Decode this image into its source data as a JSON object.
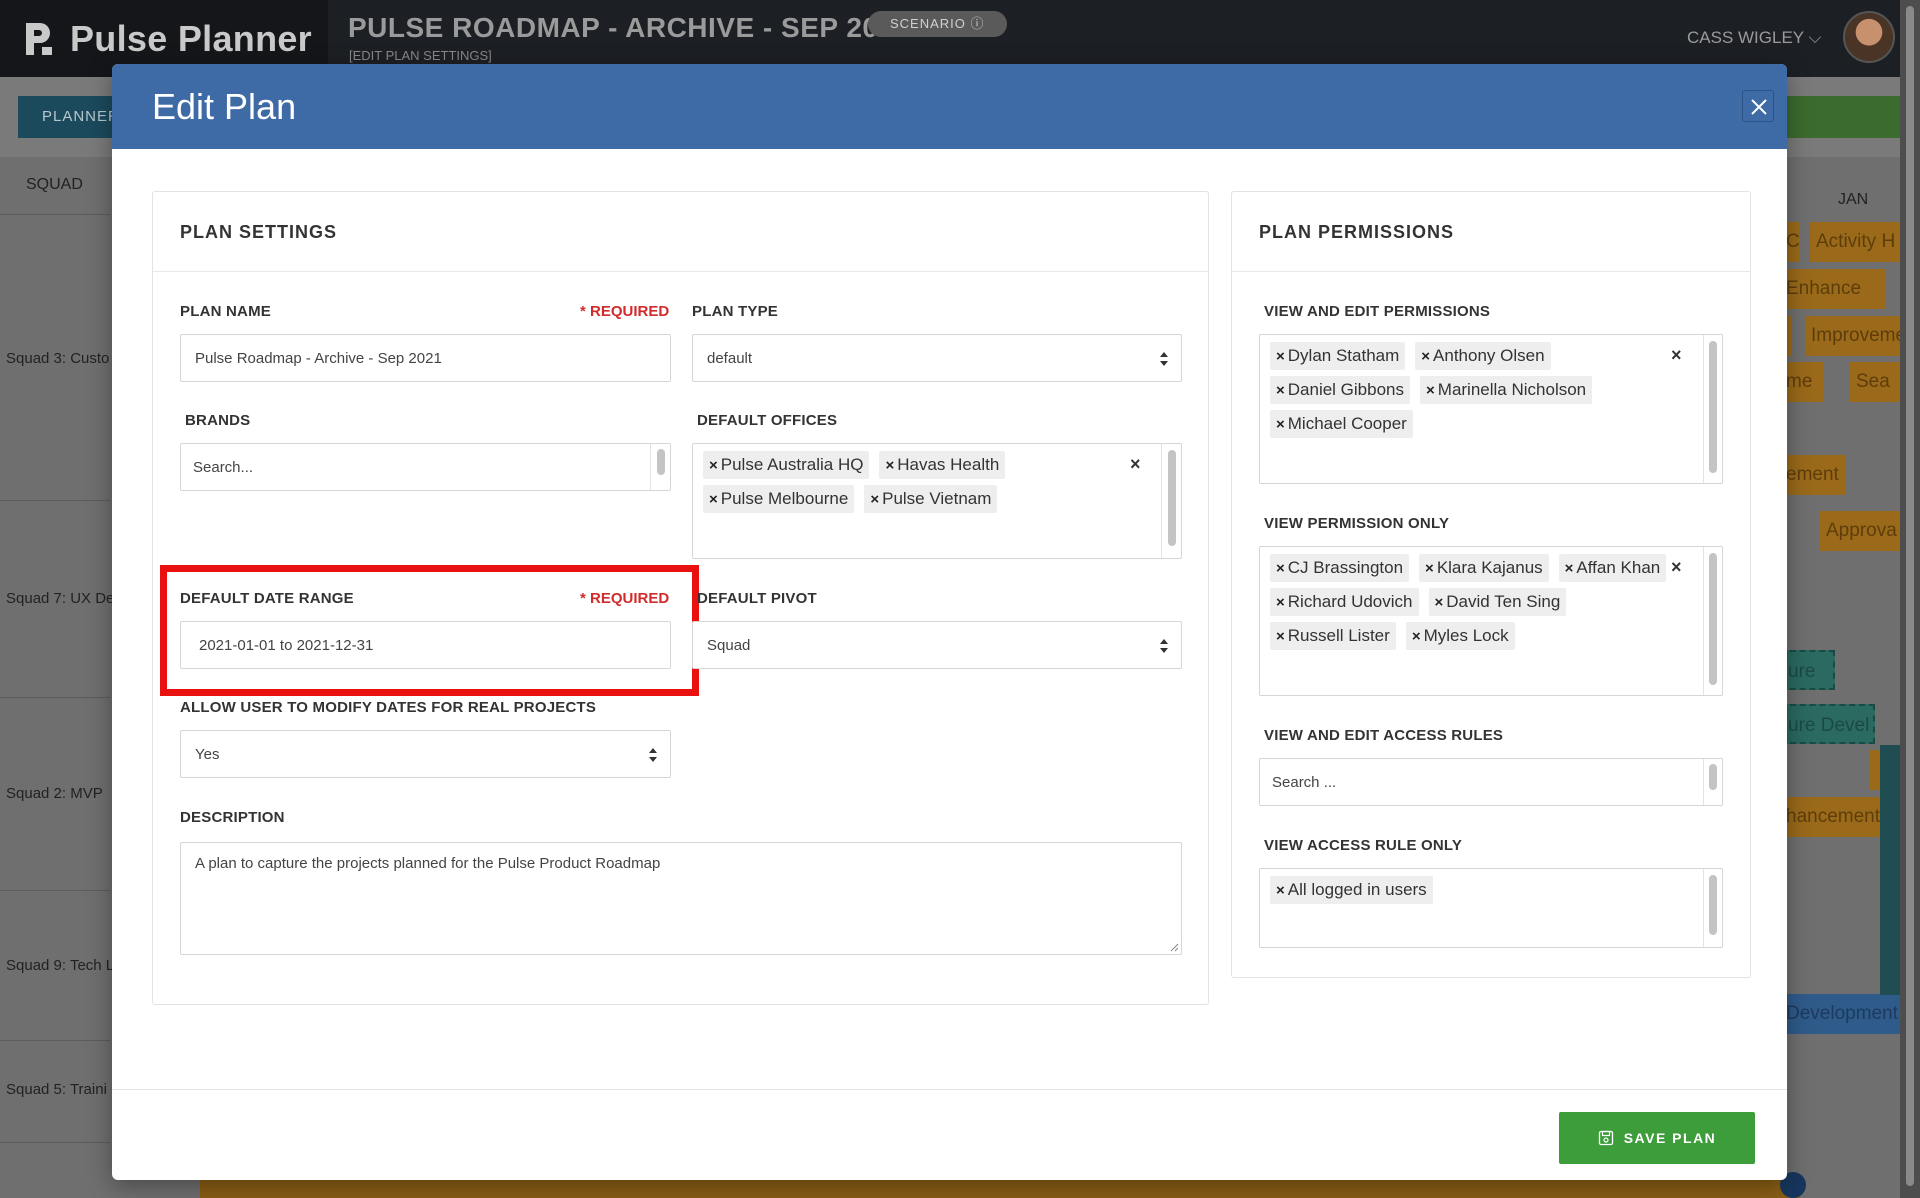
{
  "app": {
    "brand": "Pulse Planner",
    "plan_title": "PULSE ROADMAP - ARCHIVE - SEP 2021",
    "plan_subtitle": "[EDIT PLAN SETTINGS]",
    "scenario_badge": "SCENARIO ⓘ",
    "user_name": "CASS WIGLEY ⌵",
    "planner_button": "PLANNER",
    "squad_header": "SQUAD",
    "month_label": "JAN",
    "squads": [
      "Squad 3: Custo",
      "Squad 7: UX De",
      "Squad 2: MVP",
      "Squad 9: Tech L",
      "Squad 5: Traini"
    ],
    "timeline_bars": [
      "C",
      "Activity H",
      "Enhance",
      "Improveme",
      "me",
      "Sea",
      "ement",
      "Approva",
      "ure",
      "ure Devel",
      "hancement",
      "Development ("
    ]
  },
  "modal": {
    "title": "Edit Plan",
    "plan_settings": {
      "title": "PLAN SETTINGS",
      "plan_name_label": "PLAN NAME",
      "required_label": "* REQUIRED",
      "plan_name_value": "Pulse Roadmap - Archive - Sep 2021",
      "plan_type_label": "PLAN TYPE",
      "plan_type_value": "default",
      "brands_label": "BRANDS",
      "brands_placeholder": "Search...",
      "default_offices_label": "DEFAULT OFFICES",
      "default_offices": [
        "Pulse Australia HQ",
        "Havas Health",
        "Pulse Melbourne",
        "Pulse Vietnam"
      ],
      "date_range_label": "DEFAULT DATE RANGE",
      "date_range_value": "2021-01-01 to 2021-12-31",
      "default_pivot_label": "DEFAULT PIVOT",
      "default_pivot_value": "Squad",
      "modify_dates_label": "ALLOW USER TO MODIFY DATES FOR REAL PROJECTS",
      "modify_dates_value": "Yes",
      "description_label": "DESCRIPTION",
      "description_value": "A plan to capture the projects planned for the Pulse Product Roadmap"
    },
    "plan_permissions": {
      "title": "PLAN PERMISSIONS",
      "view_edit_label": "VIEW AND EDIT PERMISSIONS",
      "view_edit_users": [
        "Dylan Statham",
        "Anthony Olsen",
        "Daniel Gibbons",
        "Marinella Nicholson",
        "Michael Cooper"
      ],
      "view_only_label": "VIEW PERMISSION ONLY",
      "view_only_users": [
        "CJ Brassington",
        "Klara Kajanus",
        "Affan Khan",
        "Richard Udovich",
        "David Ten Sing",
        "Russell Lister",
        "Myles Lock"
      ],
      "edit_access_rules_label": "VIEW AND EDIT ACCESS RULES",
      "edit_access_rules_placeholder": "Search ...",
      "view_access_rule_label": "VIEW ACCESS RULE ONLY",
      "view_access_rules": [
        "All logged in users"
      ]
    },
    "save_button": "SAVE PLAN",
    "colors": {
      "header": "#3e6aa6",
      "save": "#3d9d3a",
      "required": "#d12b2b",
      "highlight": "#e8110f"
    }
  }
}
